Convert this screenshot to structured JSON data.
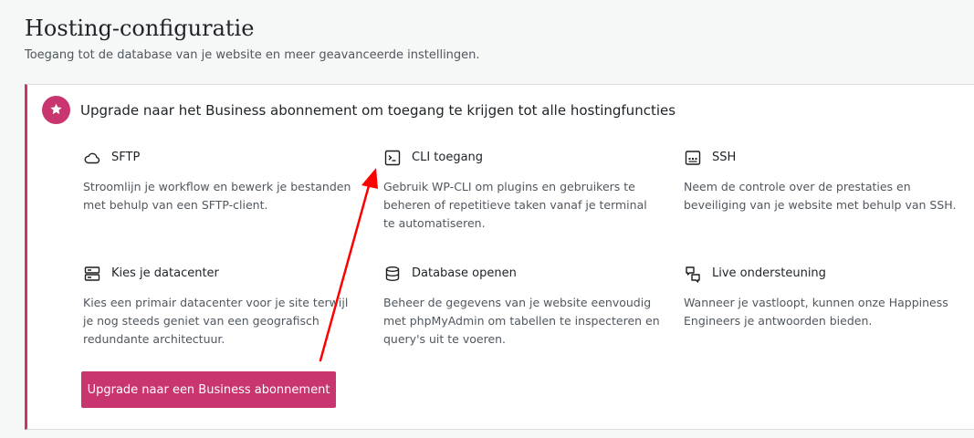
{
  "header": {
    "title": "Hosting-configuratie",
    "subtitle": "Toegang tot de database van je website en meer geavanceerde instellingen."
  },
  "upsell": {
    "heading": "Upgrade naar het Business abonnement om toegang te krijgen tot alle hostingfuncties",
    "badge_icon": "star-icon",
    "accent_color": "#c9356e",
    "features": [
      {
        "icon": "cloud-icon",
        "title": "SFTP",
        "description": "Stroomlijn je workflow en bewerk je bestanden met behulp van een SFTP-client."
      },
      {
        "icon": "terminal-icon",
        "title": "CLI toegang",
        "description": "Gebruik WP-CLI om plugins en gebruikers te beheren of repetitieve taken vanaf je terminal te automatiseren."
      },
      {
        "icon": "ssh-icon",
        "title": "SSH",
        "description": "Neem de controle over de prestaties en beveiliging van je website met behulp van SSH."
      },
      {
        "icon": "server-icon",
        "title": "Kies je datacenter",
        "description": "Kies een primair datacenter voor je site terwijl je nog steeds geniet van een geografisch redundante architectuur."
      },
      {
        "icon": "database-icon",
        "title": "Database openen",
        "description": "Beheer de gegevens van je website eenvoudig met phpMyAdmin om tabellen te inspecteren en query's uit te voeren."
      },
      {
        "icon": "chat-bubbles-icon",
        "title": "Live ondersteuning",
        "description": "Wanneer je vastloopt, kunnen onze Happiness Engineers je antwoorden bieden."
      }
    ],
    "button_label": "Upgrade naar een Business abonnement"
  },
  "annotation": {
    "type": "arrow",
    "color": "#ff0000",
    "target": "CLI toegang"
  }
}
